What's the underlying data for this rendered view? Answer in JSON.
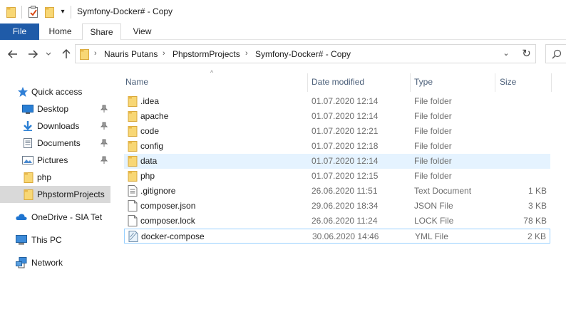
{
  "window": {
    "title": "Symfony-Docker# - Copy",
    "quick_access_toolbar": {
      "icons": [
        "folder-icon",
        "properties-icon",
        "new-folder-icon",
        "customize-dropdown-icon"
      ]
    }
  },
  "ribbon": {
    "tabs": [
      {
        "label": "File",
        "active": true
      },
      {
        "label": "Home"
      },
      {
        "label": "Share"
      },
      {
        "label": "View"
      }
    ]
  },
  "navigation": {
    "back_icon": "back-arrow-icon",
    "forward_icon": "forward-arrow-icon",
    "recent_icon": "chevron-down-icon",
    "up_icon": "up-arrow-icon",
    "breadcrumb": [
      "Nauris Putans",
      "PhpstormProjects",
      "Symfony-Docker# - Copy"
    ],
    "separator": "›",
    "refresh_icon": "refresh-icon",
    "search_icon": "search-icon"
  },
  "sidebar": {
    "items": [
      {
        "label": "Quick access",
        "icon": "star-icon"
      },
      {
        "label": "Desktop",
        "icon": "desktop-icon",
        "pinned": true
      },
      {
        "label": "Downloads",
        "icon": "download-icon",
        "pinned": true
      },
      {
        "label": "Documents",
        "icon": "documents-icon",
        "pinned": true
      },
      {
        "label": "Pictures",
        "icon": "pictures-icon",
        "pinned": true
      },
      {
        "label": "php",
        "icon": "folder-icon"
      },
      {
        "label": "PhpstormProjects",
        "icon": "folder-icon",
        "selected": true
      },
      {
        "label": "OneDrive - SIA Tet",
        "icon": "cloud-icon"
      },
      {
        "label": "This PC",
        "icon": "computer-icon"
      },
      {
        "label": "Network",
        "icon": "network-icon"
      }
    ]
  },
  "file_list": {
    "columns": [
      "Name",
      "Date modified",
      "Type",
      "Size"
    ],
    "rows": [
      {
        "name": ".idea",
        "date": "01.07.2020 12:14",
        "type": "File folder",
        "size": "",
        "icon": "folder-icon"
      },
      {
        "name": "apache",
        "date": "01.07.2020 12:14",
        "type": "File folder",
        "size": "",
        "icon": "folder-icon"
      },
      {
        "name": "code",
        "date": "01.07.2020 12:21",
        "type": "File folder",
        "size": "",
        "icon": "folder-icon"
      },
      {
        "name": "config",
        "date": "01.07.2020 12:18",
        "type": "File folder",
        "size": "",
        "icon": "folder-icon"
      },
      {
        "name": "data",
        "date": "01.07.2020 12:14",
        "type": "File folder",
        "size": "",
        "icon": "folder-icon",
        "hover": true
      },
      {
        "name": "php",
        "date": "01.07.2020 12:15",
        "type": "File folder",
        "size": "",
        "icon": "folder-icon"
      },
      {
        "name": ".gitignore",
        "date": "26.06.2020 11:51",
        "type": "Text Document",
        "size": "1 KB",
        "icon": "text-file-icon"
      },
      {
        "name": "composer.json",
        "date": "29.06.2020 18:34",
        "type": "JSON File",
        "size": "3 KB",
        "icon": "file-icon"
      },
      {
        "name": "composer.lock",
        "date": "26.06.2020 11:24",
        "type": "LOCK File",
        "size": "78 KB",
        "icon": "file-icon"
      },
      {
        "name": "docker-compose",
        "date": "30.06.2020 14:46",
        "type": "YML File",
        "size": "2 KB",
        "icon": "yml-file-icon",
        "focused": true
      }
    ]
  },
  "colors": {
    "file_tab": "#1f5ba8",
    "folder": "#f8d775",
    "hover_row": "#e5f3ff",
    "selected_sidebar": "#d9d9d9",
    "header_text": "#4c607a"
  }
}
